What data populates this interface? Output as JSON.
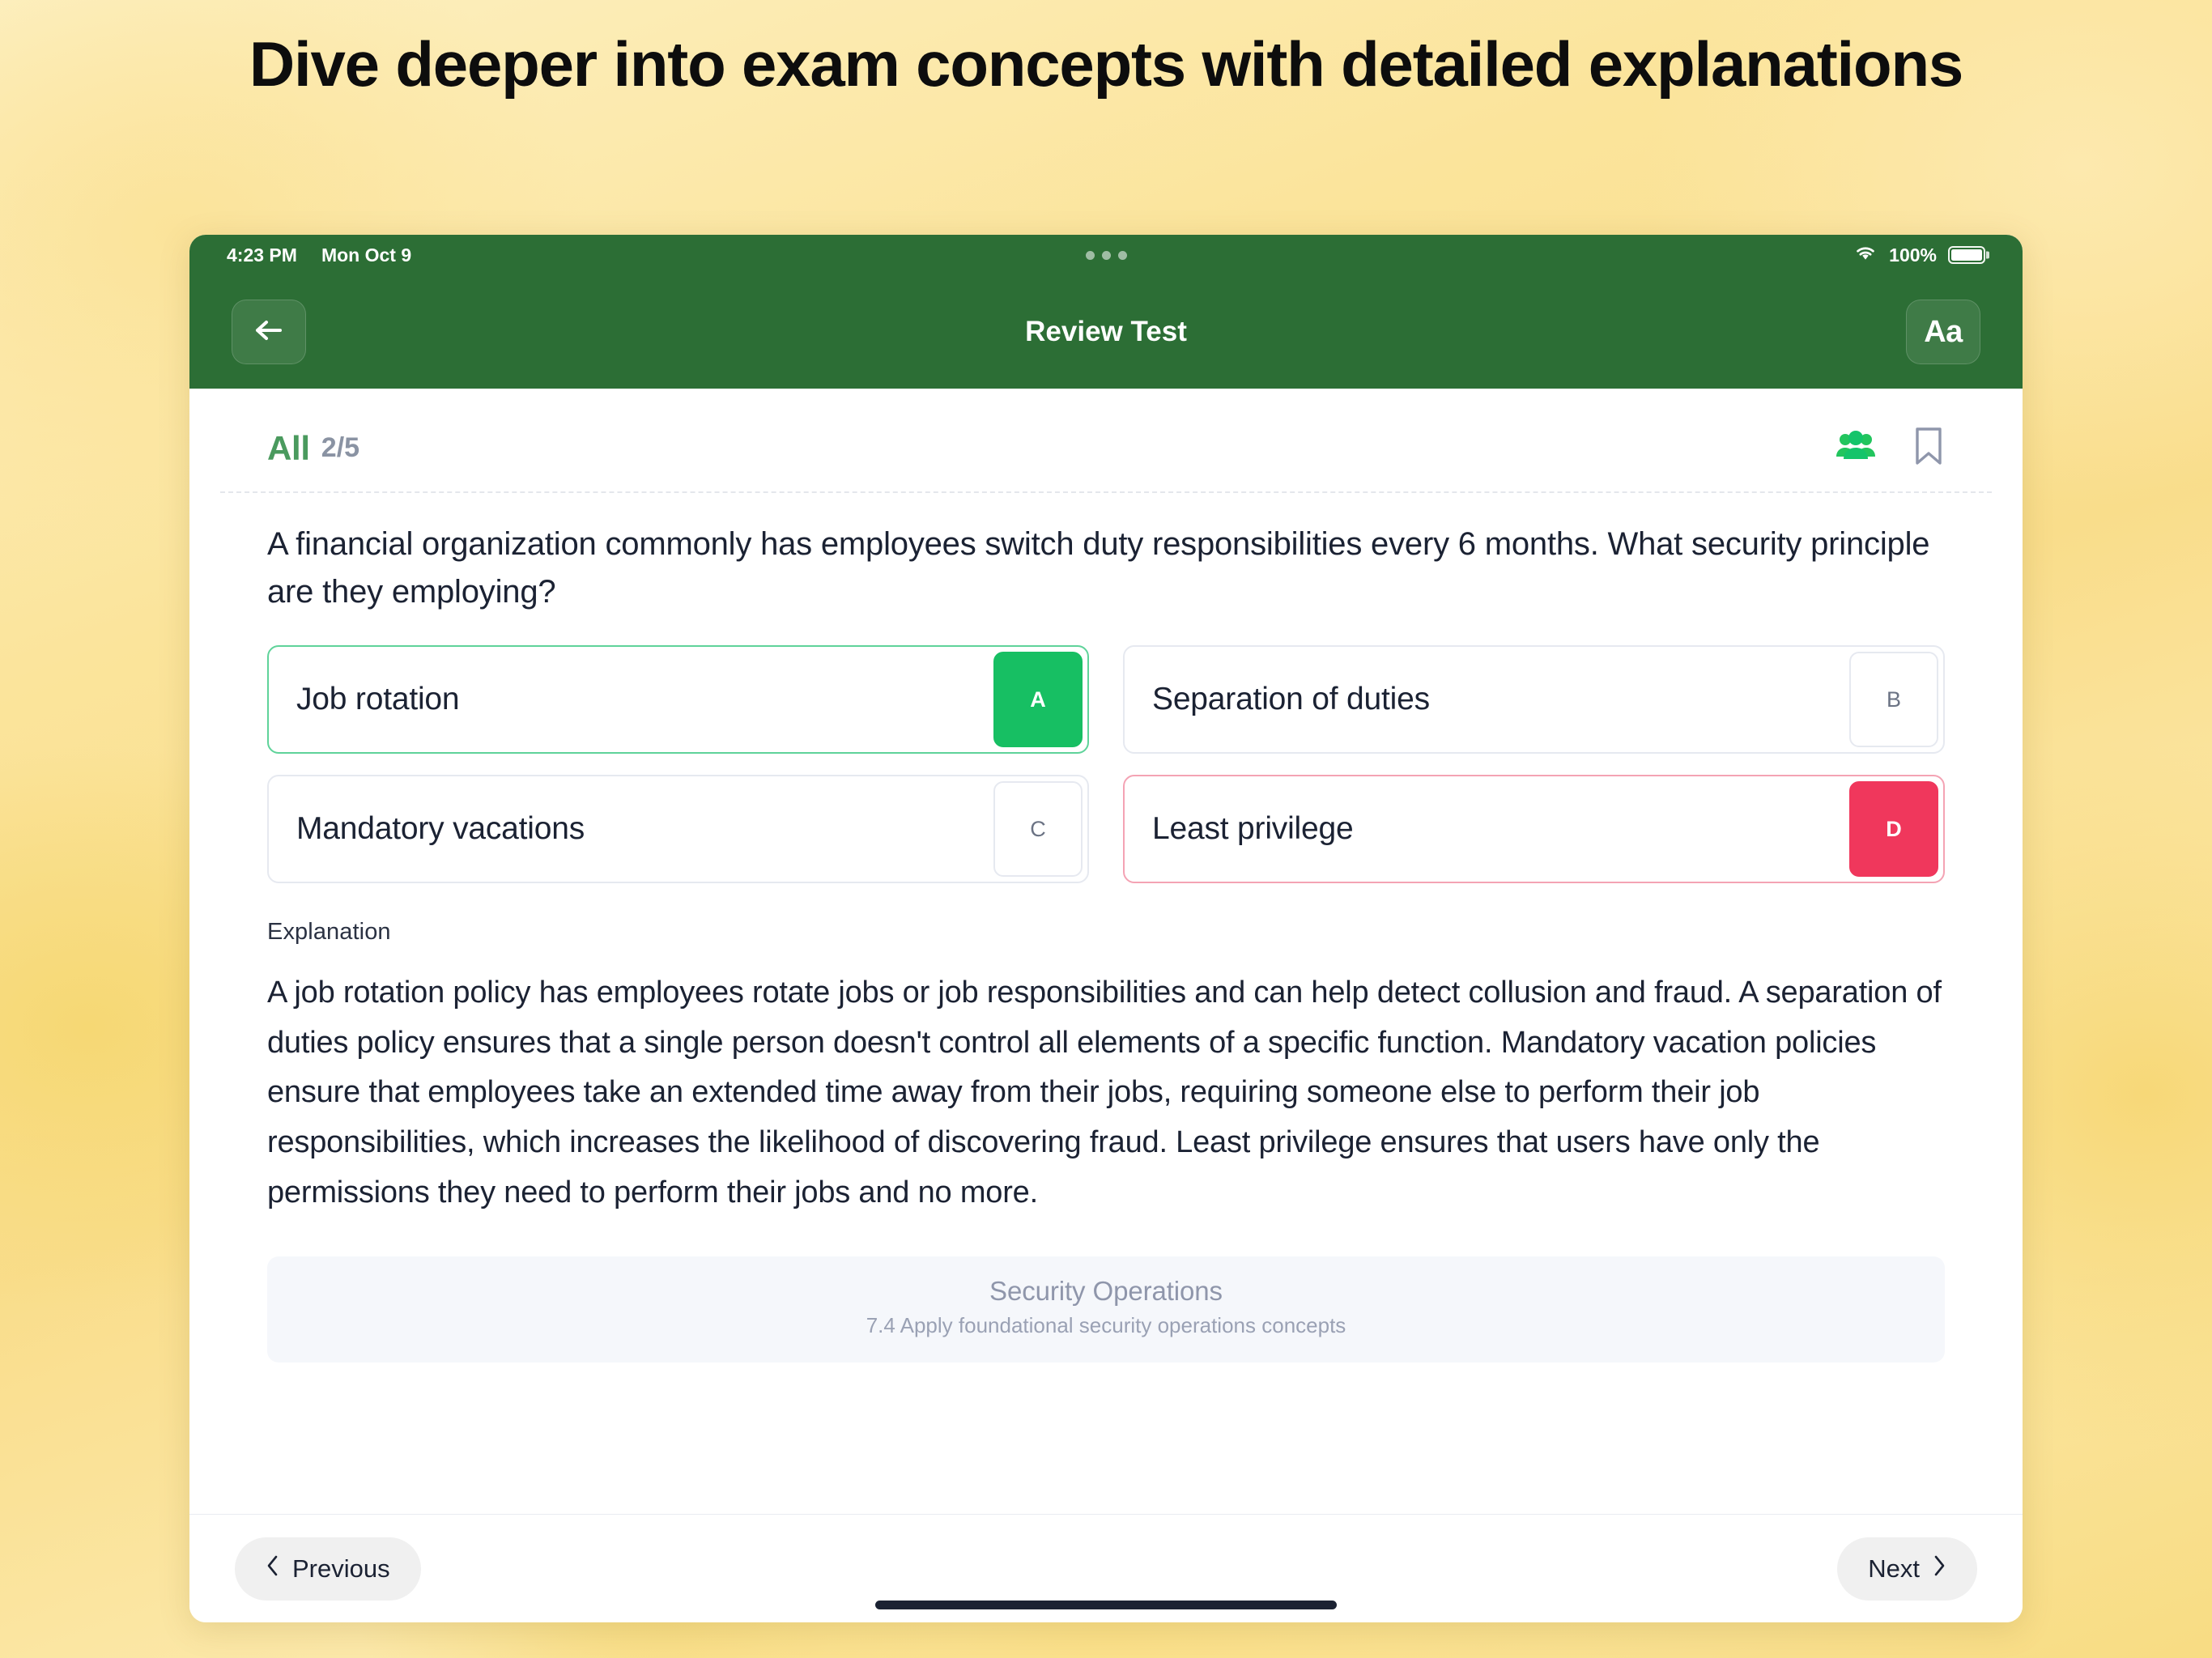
{
  "headline": "Dive deeper into exam concepts with detailed explanations",
  "statusbar": {
    "time": "4:23 PM",
    "date": "Mon Oct 9",
    "battery_percent": "100%",
    "wifi_icon": "wifi-icon",
    "battery_icon": "battery-full-icon",
    "multitask_icon": "multitask-dots-icon"
  },
  "navbar": {
    "back_icon": "back-arrow-icon",
    "title": "Review Test",
    "text_size_label": "Aa"
  },
  "meta": {
    "filter_label": "All",
    "progress": "2/5",
    "community_icon": "people-group-icon",
    "bookmark_icon": "bookmark-outline-icon"
  },
  "question": {
    "text": "A financial organization commonly has employees switch duty responsibilities every 6 months. What security principle are they employing?",
    "options": [
      {
        "letter": "A",
        "text": "Job rotation",
        "state": "correct"
      },
      {
        "letter": "B",
        "text": "Separation of duties",
        "state": "neutral"
      },
      {
        "letter": "C",
        "text": "Mandatory vacations",
        "state": "neutral"
      },
      {
        "letter": "D",
        "text": "Least privilege",
        "state": "wrong"
      }
    ]
  },
  "explanation": {
    "label": "Explanation",
    "body": "A job rotation policy has employees rotate jobs or job responsibilities and can help detect collusion and fraud. A separation of duties policy ensures that a single person doesn't control all elements of a specific function. Mandatory vacation policies ensure that employees take an extended time away from their jobs, requiring someone else to perform their job responsibilities, which increases the likelihood of discovering fraud. Least privilege ensures that users have only the permissions they need to perform their jobs and no more."
  },
  "domain_card": {
    "title": "Security Operations",
    "subtitle": "7.4 Apply foundational security operations concepts"
  },
  "footer": {
    "previous_label": "Previous",
    "next_label": "Next",
    "prev_icon": "chevron-left-icon",
    "next_icon": "chevron-right-icon"
  },
  "colors": {
    "header_green": "#2c6e35",
    "accent_green": "#17bf63",
    "filter_green": "#4a9a5e",
    "wrong_red": "#f0375c",
    "page_background": "#f9dd8b"
  }
}
